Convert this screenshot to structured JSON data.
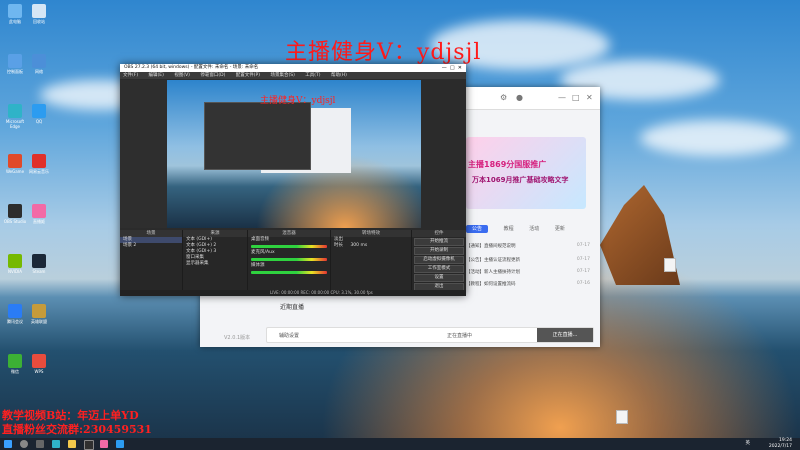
{
  "overlay": {
    "title": "主播健身V：ydjsjl",
    "bottom_line1": "教学视频B站：年迈上单YD",
    "bottom_line2": "直播粉丝交流群:230459531"
  },
  "desktop_icons": [
    {
      "label": "此电脑",
      "color": "#6fb7f0"
    },
    {
      "label": "回收站",
      "color": "#d5e6f5"
    },
    {
      "label": "控制面板",
      "color": "#5aa0e6"
    },
    {
      "label": "网络",
      "color": "#4c8fd8"
    },
    {
      "label": "Microsoft Edge",
      "color": "#2fb3c8"
    },
    {
      "label": "QQ",
      "color": "#2c9cf0"
    },
    {
      "label": "WeGame",
      "color": "#e04a2a"
    },
    {
      "label": "网易云音乐",
      "color": "#e0302a"
    },
    {
      "label": "OBS Studio",
      "color": "#2d2d2d"
    },
    {
      "label": "直播姬",
      "color": "#f26aa6"
    },
    {
      "label": "NVIDIA",
      "color": "#76b900"
    },
    {
      "label": "Steam",
      "color": "#1b2838"
    },
    {
      "label": "腾讯会议",
      "color": "#2a7cf5"
    },
    {
      "label": "英雄联盟",
      "color": "#c69b3a"
    },
    {
      "label": "微信",
      "color": "#3cb035"
    },
    {
      "label": "WPS",
      "color": "#e84c3d"
    }
  ],
  "obs": {
    "title": "OBS 27.2.3 (64 bit, windows) - 配置文件: 未命名 - 场景: 未命名",
    "menu": [
      "文件(F)",
      "编辑(E)",
      "视图(V)",
      "停靠窗口(D)",
      "配置文件(P)",
      "场景集合(S)",
      "工具(T)",
      "帮助(H)"
    ],
    "preview_title": "主播健身V：ydjsjl",
    "panels": {
      "scenes_header": "场景",
      "scenes": [
        "场景",
        "场景 2"
      ],
      "sources_header": "来源",
      "sources": [
        "文本 (GDI+)",
        "文本 (GDI+) 2",
        "文本 (GDI+) 3",
        "窗口采集",
        "显示器采集"
      ],
      "mixer_header": "混音器",
      "mixer_tracks": [
        "桌面音频",
        "麦克风/Aux",
        "媒体源"
      ],
      "transitions_header": "转场特效",
      "transition_value": "淡出",
      "duration_label": "时长",
      "duration_value": "300 ms",
      "controls_header": "控件",
      "controls": [
        "开始推流",
        "开始录制",
        "启动虚拟摄像机",
        "工作室模式",
        "设置",
        "退出"
      ]
    },
    "status": "LIVE: 00:00:00   REC: 00:00:00   CPU: 3.1%, 30.00 fps"
  },
  "assistant": {
    "tabs": [
      "公告",
      "教程",
      "活动",
      "更新"
    ],
    "active_tab": "公告",
    "banner_line1": "主播1869分国服推广",
    "banner_line2": "万本1069月推广基础攻略文字",
    "news": [
      {
        "text": "【通知】直播间规范说明",
        "date": "07-17"
      },
      {
        "text": "【公告】主播认证流程更新",
        "date": "07-17"
      },
      {
        "text": "【活动】新人主播扶持计划",
        "date": "07-17"
      },
      {
        "text": "【教程】如何设置推流码",
        "date": "07-16"
      }
    ],
    "recent_label": "近期直播",
    "bottom_left": "辅助设置",
    "bottom_mid": "正在直播中",
    "start_button": "正在直播...",
    "version": "V2.0.1版本"
  },
  "taskbar": {
    "time": "19:24",
    "date": "2022/7/17",
    "lang": "英"
  },
  "colors": {
    "overlay_red": "#ff1a1a",
    "accent_blue": "#3a6cf0",
    "obs_dark": "#2b2b2b"
  }
}
